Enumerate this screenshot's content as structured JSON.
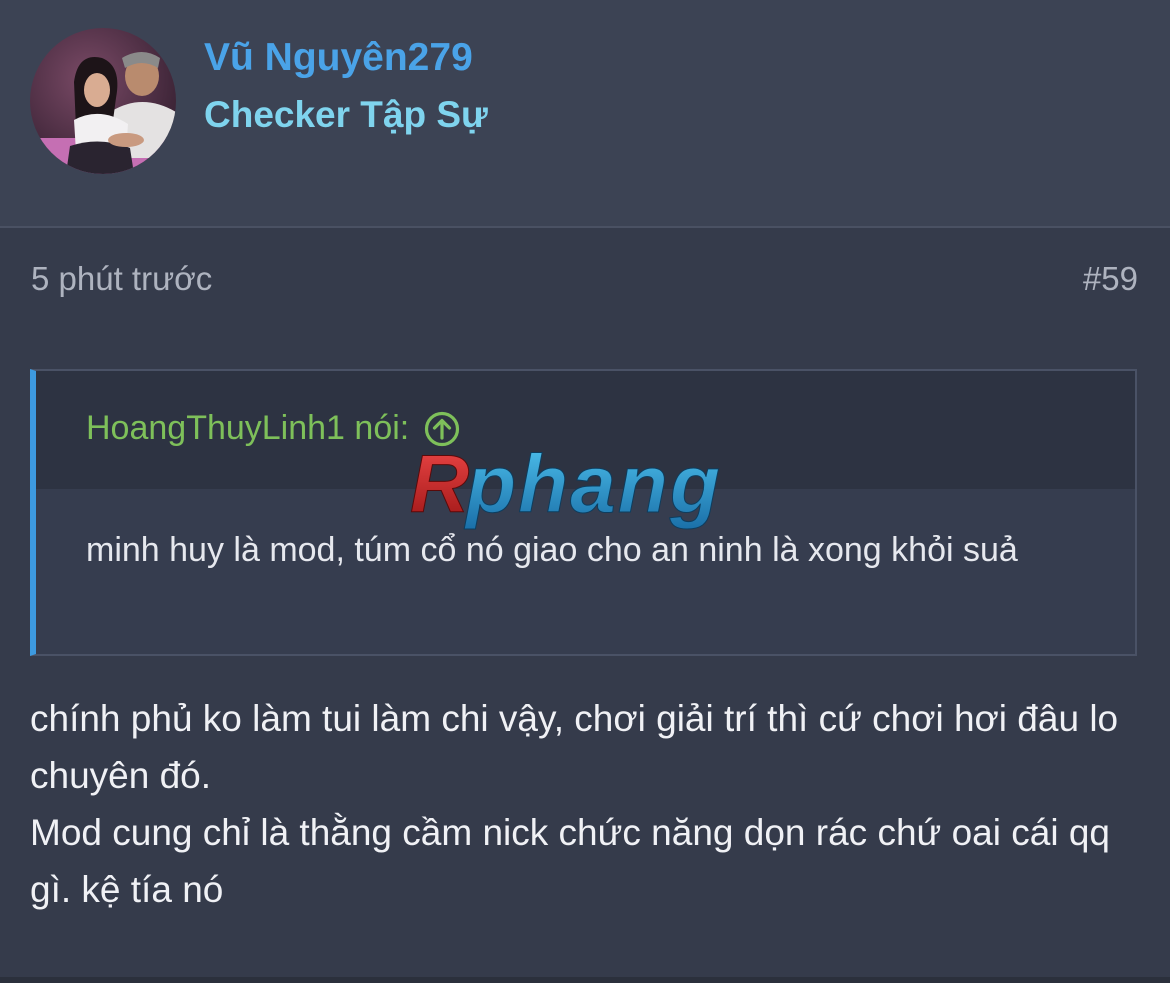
{
  "user": {
    "name": "Vũ Nguyên279",
    "title": "Checker Tập Sự",
    "avatar_icon": "user-avatar-photo"
  },
  "post": {
    "time": "5 phút trước",
    "number": "#59",
    "paragraphs": [
      "chính phủ ko làm tui làm chi vậy, chơi giải trí thì cứ chơi hơi đâu lo chuyên đó.",
      "Mod cung chỉ là thằng cầm nick chức năng dọn rác chứ oai cái qq gì. kệ tía nó"
    ]
  },
  "quote": {
    "author": "HoangThuyLinh1 nói:",
    "jump_icon": "arrow-up-circle-icon",
    "text": "minh huy là mod, túm cổ nó giao cho an ninh là xong khỏi suả"
  },
  "watermark": {
    "text": "Rphang"
  },
  "colors": {
    "background": "#353b4b",
    "header_bg": "#3c4354",
    "username": "#4aa3e8",
    "user_title": "#7fd4ee",
    "quote_author": "#7ec05a",
    "quote_border": "#3d9ae0"
  }
}
